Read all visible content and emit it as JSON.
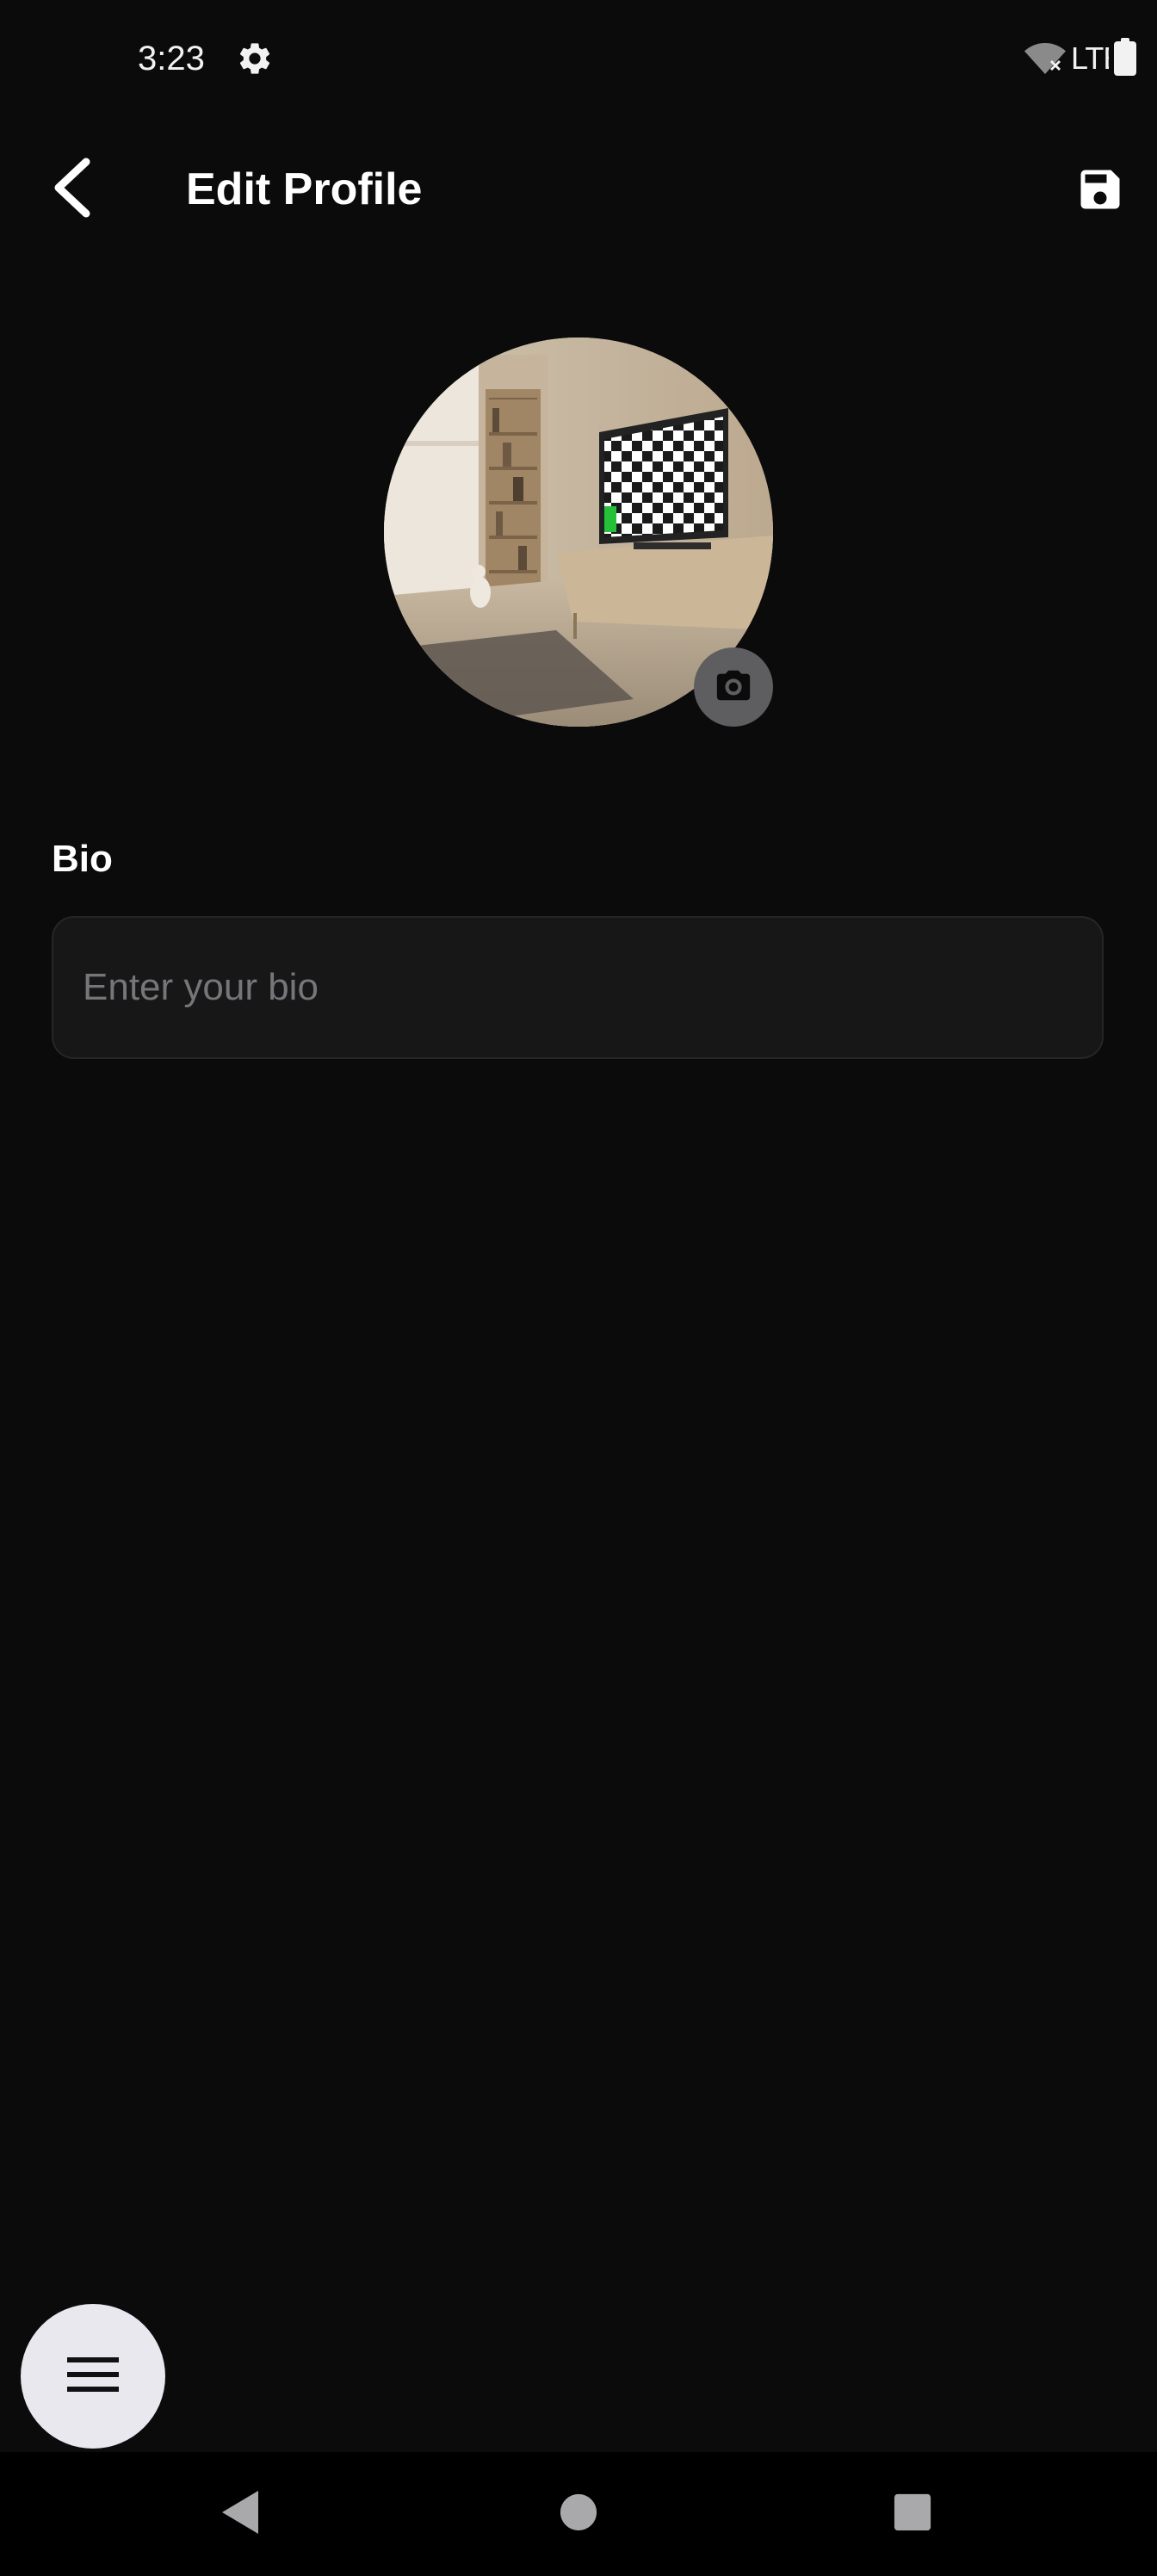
{
  "status_bar": {
    "time": "3:23",
    "network_label": "LTE",
    "icons": [
      "settings-gear-icon",
      "wifi-off-icon",
      "battery-icon"
    ]
  },
  "app_bar": {
    "title": "Edit Profile",
    "back_icon": "chevron-left-icon",
    "save_icon": "floppy-disk-save-icon"
  },
  "profile": {
    "avatar_alt": "profile photo",
    "camera_icon": "camera-icon"
  },
  "bio": {
    "label": "Bio",
    "placeholder": "Enter your bio",
    "value": ""
  },
  "fab": {
    "icon": "hamburger-menu-icon"
  },
  "nav_bar": {
    "icons": [
      "nav-back-triangle-icon",
      "nav-home-circle-icon",
      "nav-recents-square-icon"
    ]
  },
  "colors": {
    "background": "#0b0b0c",
    "input_background": "#171718",
    "placeholder": "#76767a",
    "fab_background": "#e9e8ee",
    "camera_badge": "#5e5e60"
  }
}
